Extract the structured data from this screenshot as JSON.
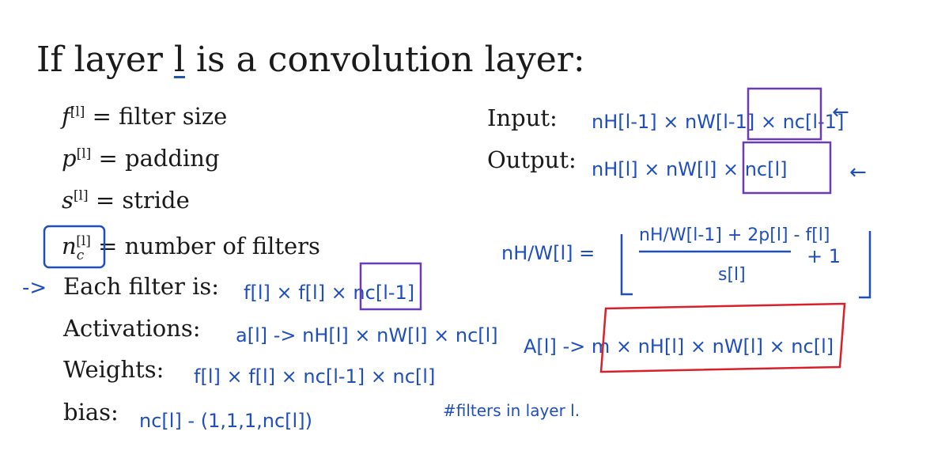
{
  "title": {
    "prefix": "If layer ",
    "var": "l",
    "suffix": " is a convolution layer:"
  },
  "definitions": [
    {
      "symbol": "f",
      "sup": "[l]",
      "text": "= filter size"
    },
    {
      "symbol": "p",
      "sup": "[l]",
      "text": "= padding"
    },
    {
      "symbol": "s",
      "sup": "[l]",
      "text": "= stride"
    },
    {
      "symbol": "n",
      "sub": "c",
      "sup": "[l]",
      "text": "= number of filters"
    }
  ],
  "labels": {
    "each_filter": "Each filter is:",
    "activations": "Activations:",
    "weights": "Weights:",
    "bias": "bias:",
    "input": "Input:",
    "output": "Output:"
  },
  "handwriting": {
    "arrow_left": "->",
    "filter_expr": "f[l] × f[l] × nc[l-1]",
    "activation_expr": "a[l] -> nH[l] × nW[l] × nc[l]",
    "weights_expr": "f[l] × f[l] × nc[l-1] × nc[l]",
    "bias_expr": "nc[l] - (1,1,1,nc[l])",
    "bias_note": "#filters in layer l.",
    "input_expr": "nH[l-1] × nW[l-1] × nc[l-1]",
    "output_expr": "nH[l] × nW[l] × nc[l]",
    "formula_lhs": "nH/W[l] =",
    "formula_num": "nH/W[l-1] + 2p[l] - f[l]",
    "formula_den": "s[l]",
    "formula_plus": "+ 1",
    "A_expr": "A[l] -> m × nH[l] × nW[l] × nc[l]"
  },
  "colors": {
    "ink_blue": "#1f4fbf",
    "ink_purple": "#6a3bb5",
    "ink_red": "#d9202a"
  }
}
